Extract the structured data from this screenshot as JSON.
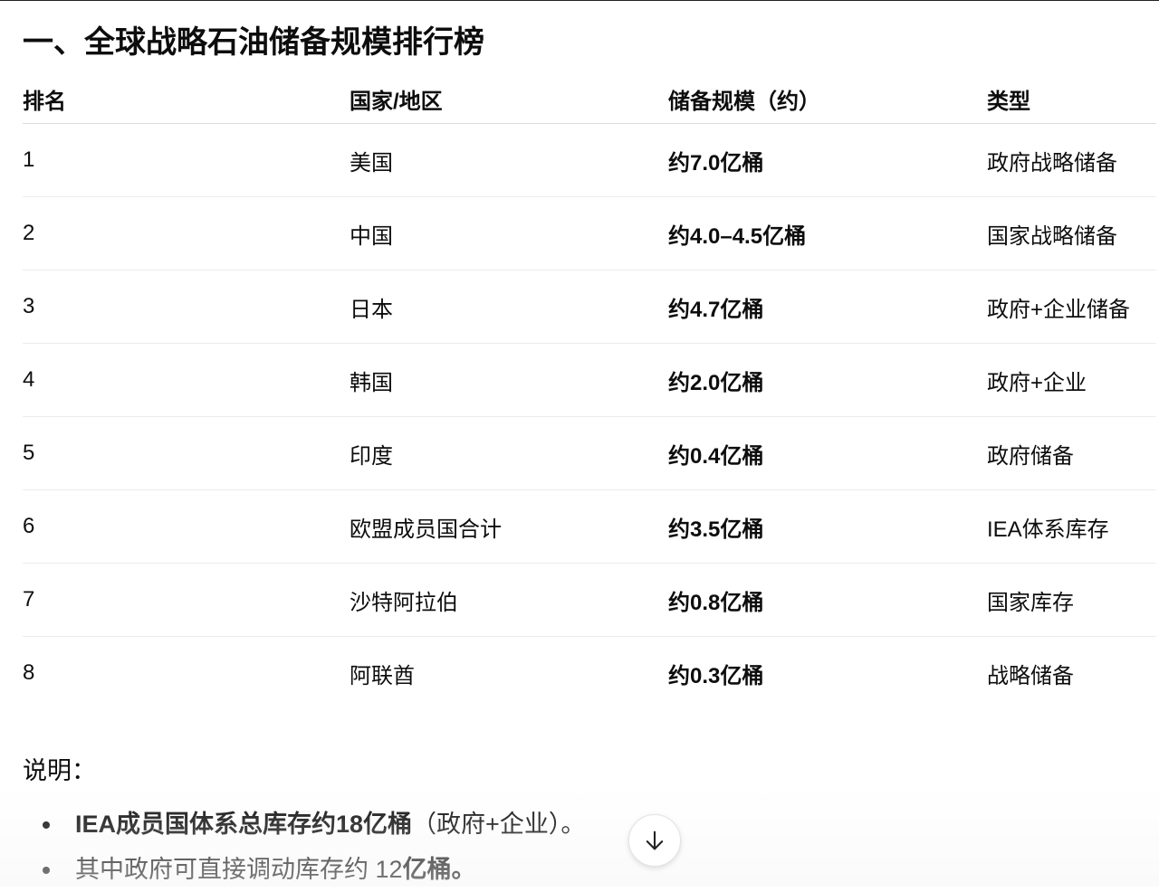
{
  "heading": "一、全球战略石油储备规模排行榜",
  "table": {
    "headers": [
      "排名",
      "国家/地区",
      "储备规模（约）",
      "类型"
    ],
    "rows": [
      [
        "1",
        "美国",
        "约7.0亿桶",
        "政府战略储备"
      ],
      [
        "2",
        "中国",
        "约4.0–4.5亿桶",
        "国家战略储备"
      ],
      [
        "3",
        "日本",
        "约4.7亿桶",
        "政府+企业储备"
      ],
      [
        "4",
        "韩国",
        "约2.0亿桶",
        "政府+企业"
      ],
      [
        "5",
        "印度",
        "约0.4亿桶",
        "政府储备"
      ],
      [
        "6",
        "欧盟成员国合计",
        "约3.5亿桶",
        "IEA体系库存"
      ],
      [
        "7",
        "沙特阿拉伯",
        "约0.8亿桶",
        "国家库存"
      ],
      [
        "8",
        "阿联酋",
        "约0.3亿桶",
        "战略储备"
      ]
    ]
  },
  "notes": {
    "title": "说明：",
    "items": [
      {
        "bold": "IEA成员国体系总库存约18亿桶",
        "rest": "（政府+企业）。"
      },
      {
        "plain": "其中政府可直接调动库存约 12",
        "bold": "亿桶。"
      }
    ]
  },
  "scroll_button": {
    "icon": "arrow-down-icon"
  }
}
